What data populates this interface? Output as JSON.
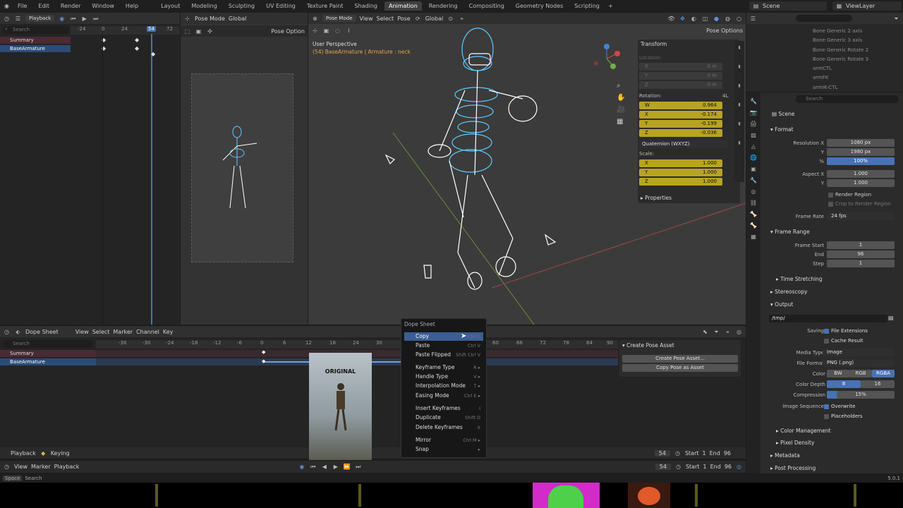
{
  "app": {
    "menus": [
      "File",
      "Edit",
      "Render",
      "Window",
      "Help"
    ],
    "workspaces": [
      "Layout",
      "Modeling",
      "Sculpting",
      "UV Editing",
      "Texture Paint",
      "Shading",
      "Animation",
      "Rendering",
      "Compositing",
      "Geometry Nodes",
      "Scripting"
    ],
    "active_workspace": "Animation",
    "scene": "Scene",
    "view_layer": "ViewLayer",
    "version": "5.0.1"
  },
  "top_left_editor": {
    "playback": "Playback",
    "search_placeholder": "Search",
    "channels": [
      "Summary",
      "BaseArmature"
    ],
    "ticks": [
      "-24",
      "0",
      "24",
      "54",
      "72"
    ]
  },
  "camera_view": {
    "mode": "Pose Mode",
    "orientation": "Global",
    "pose_options": "Pose Option"
  },
  "viewport": {
    "mode": "Pose Mode",
    "menus": [
      "View",
      "Select",
      "Pose"
    ],
    "orientation": "Global",
    "pose_options": "Pose Options",
    "perspective": "User Perspective",
    "object_info": "(54) BaseArmature | Armature : neck"
  },
  "transform": {
    "title": "Transform",
    "location_label": "Location:",
    "loc_axes": [
      "X",
      "Y",
      "Z"
    ],
    "loc_values": [
      "0 m",
      "0 m",
      "0 m"
    ],
    "rotation_label": "Rotation:",
    "rotation_mode_value": "4L",
    "rot_axes": [
      "W",
      "X",
      "Y",
      "Z"
    ],
    "rot_values": [
      "0.964",
      "-0.174",
      "-0.199",
      "-0.036"
    ],
    "rot_mode": "Quaternion (WXYZ)",
    "scale_label": "Scale:",
    "scale_axes": [
      "X",
      "Y",
      "Z"
    ],
    "scale_values": [
      "1.000",
      "1.000",
      "1.000"
    ],
    "properties": "Properties"
  },
  "outliner": {
    "items": [
      "Bone Generic 2 axis",
      "Bone Generic 3 axis",
      "Bone Generic Rotate 2",
      "Bone Generic Rotate 3",
      "armCTL",
      "armFK",
      "armIK-CTL"
    ]
  },
  "properties": {
    "search_placeholder": "Search",
    "scene": "Scene",
    "format": "Format",
    "resolution_x_label": "Resolution X",
    "resolution_x": "1080 px",
    "y_label": "Y",
    "resolution_y": "1980 px",
    "pct_label": "%",
    "resolution_pct": "100%",
    "aspect_x_label": "Aspect X",
    "aspect_x": "1.000",
    "aspect_y": "1.000",
    "render_region": "Render Region",
    "crop": "Crop to Render Region",
    "frame_rate_label": "Frame Rate",
    "frame_rate": "24 fps",
    "frame_range": "Frame Range",
    "frame_start_label": "Frame Start",
    "frame_start": "1",
    "end_label": "End",
    "frame_end": "96",
    "step_label": "Step",
    "step": "1",
    "time_stretching": "Time Stretching",
    "stereoscopy": "Stereoscopy",
    "output": "Output",
    "path": "/tmp/",
    "saving_label": "Saving",
    "file_extensions": "File Extensions",
    "cache_result": "Cache Result",
    "media_type_label": "Media Type",
    "media_type": "Image",
    "file_format_label": "File Format",
    "file_format": "PNG (.png)",
    "color_label": "Color",
    "color_opts": [
      "BW",
      "RGB",
      "RGBA"
    ],
    "color_depth_label": "Color Depth",
    "depth_opts": [
      "8",
      "16"
    ],
    "compression_label": "Compression",
    "compression": "15%",
    "image_sequence_label": "Image Sequence",
    "overwrite": "Overwrite",
    "placeholders": "Placeholders",
    "color_management": "Color Management",
    "pixel_density": "Pixel Density",
    "metadata": "Metadata",
    "post_processing": "Post Processing"
  },
  "dopesheet": {
    "editor": "Dope Sheet",
    "menus": [
      "View",
      "Select",
      "Marker",
      "Channel",
      "Key"
    ],
    "search_placeholder": "Search",
    "ticks": [
      "-36",
      "-30",
      "-24",
      "-18",
      "-12",
      "-6",
      "0",
      "6",
      "12",
      "18",
      "24",
      "30",
      "36",
      "42",
      "48",
      "54",
      "60",
      "66",
      "72",
      "78",
      "84",
      "90"
    ],
    "channels": [
      "Summary",
      "BaseArmature"
    ],
    "playback": "Playback",
    "keying": "Keying",
    "current_frame": "54",
    "start_label": "Start",
    "start": "1",
    "end_label": "End",
    "end": "96",
    "create_pose_asset_title": "Create Pose Asset",
    "create_pose_asset_btn": "Create Pose Asset...",
    "copy_pose_btn": "Copy Pose as Asset"
  },
  "timeline": {
    "menus": [
      "View",
      "Marker",
      "Playback"
    ],
    "current_frame": "54",
    "start_label": "Start",
    "start": "1",
    "end_label": "End",
    "end": "96"
  },
  "context_menu": {
    "title": "Dope Sheet",
    "items": [
      {
        "label": "Copy",
        "shortcut": "Ctrl C"
      },
      {
        "label": "Paste",
        "shortcut": "Ctrl V"
      },
      {
        "label": "Paste Flipped",
        "shortcut": "Shift Ctrl V"
      },
      {
        "label": "Keyframe Type",
        "shortcut": "R ▸"
      },
      {
        "label": "Handle Type",
        "shortcut": "V ▸"
      },
      {
        "label": "Interpolation Mode",
        "shortcut": "T ▸"
      },
      {
        "label": "Easing Mode",
        "shortcut": "Ctrl E ▸"
      },
      {
        "label": "Insert Keyframes",
        "shortcut": "I"
      },
      {
        "label": "Duplicate",
        "shortcut": "Shift D"
      },
      {
        "label": "Delete Keyframes",
        "shortcut": "X"
      },
      {
        "label": "Mirror",
        "shortcut": "Ctrl M ▸"
      },
      {
        "label": "Snap",
        "shortcut": "▸"
      }
    ]
  },
  "overlay_video": {
    "label": "ORIGINAL"
  },
  "status": {
    "search": "Search",
    "space": "Space"
  }
}
